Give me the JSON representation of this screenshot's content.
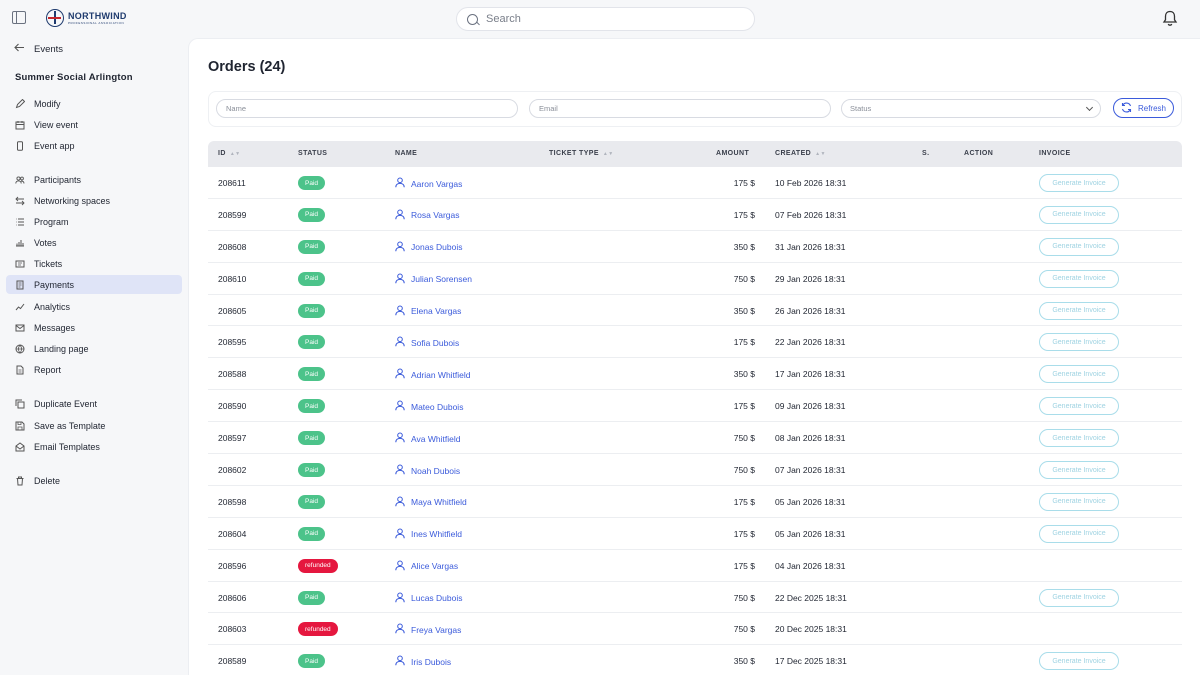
{
  "header": {
    "logo_name": "NORTHWIND",
    "logo_sub": "PROFESSIONAL ASSOCIATION",
    "search_placeholder": "Search"
  },
  "sidebar": {
    "back_label": "Events",
    "event_title": "Summer Social Arlington",
    "items": [
      {
        "label": "Modify",
        "icon": "pencil-icon"
      },
      {
        "label": "View event",
        "icon": "calendar-icon"
      },
      {
        "label": "Event app",
        "icon": "phone-icon"
      },
      {
        "label": "Participants",
        "icon": "people-icon"
      },
      {
        "label": "Networking spaces",
        "icon": "network-icon"
      },
      {
        "label": "Program",
        "icon": "list-icon"
      },
      {
        "label": "Votes",
        "icon": "vote-icon"
      },
      {
        "label": "Tickets",
        "icon": "ticket-icon"
      },
      {
        "label": "Payments",
        "icon": "receipt-icon",
        "active": true
      },
      {
        "label": "Analytics",
        "icon": "chart-icon"
      },
      {
        "label": "Messages",
        "icon": "mail-icon"
      },
      {
        "label": "Landing page",
        "icon": "globe-icon"
      },
      {
        "label": "Report",
        "icon": "document-icon"
      },
      {
        "label": "Duplicate Event",
        "icon": "copy-icon"
      },
      {
        "label": "Save as Template",
        "icon": "save-icon"
      },
      {
        "label": "Email Templates",
        "icon": "envelope-open-icon"
      },
      {
        "label": "Delete",
        "icon": "trash-icon"
      }
    ]
  },
  "main": {
    "title": "Orders (24)",
    "filters": {
      "name_placeholder": "Name",
      "email_placeholder": "Email",
      "status_placeholder": "Status",
      "refresh_label": "Refresh"
    },
    "columns": [
      "ID",
      "STATUS",
      "NAME",
      "TICKET TYPE",
      "AMOUNT",
      "CREATED",
      "S.",
      "ACTION",
      "INVOICE"
    ],
    "invoice_label": "Generate Invoice",
    "rows": [
      {
        "id": "208611",
        "status": "Paid",
        "name": "Aaron Vargas",
        "amount": "175 $",
        "created": "10 Feb 2026 18:31",
        "invoice": true
      },
      {
        "id": "208599",
        "status": "Paid",
        "name": "Rosa Vargas",
        "amount": "175 $",
        "created": "07 Feb 2026 18:31",
        "invoice": true
      },
      {
        "id": "208608",
        "status": "Paid",
        "name": "Jonas Dubois",
        "amount": "350 $",
        "created": "31 Jan 2026 18:31",
        "invoice": true
      },
      {
        "id": "208610",
        "status": "Paid",
        "name": "Julian Sorensen",
        "amount": "750 $",
        "created": "29 Jan 2026 18:31",
        "invoice": true
      },
      {
        "id": "208605",
        "status": "Paid",
        "name": "Elena Vargas",
        "amount": "350 $",
        "created": "26 Jan 2026 18:31",
        "invoice": true
      },
      {
        "id": "208595",
        "status": "Paid",
        "name": "Sofia Dubois",
        "amount": "175 $",
        "created": "22 Jan 2026 18:31",
        "invoice": true
      },
      {
        "id": "208588",
        "status": "Paid",
        "name": "Adrian Whitfield",
        "amount": "350 $",
        "created": "17 Jan 2026 18:31",
        "invoice": true
      },
      {
        "id": "208590",
        "status": "Paid",
        "name": "Mateo Dubois",
        "amount": "175 $",
        "created": "09 Jan 2026 18:31",
        "invoice": true
      },
      {
        "id": "208597",
        "status": "Paid",
        "name": "Ava Whitfield",
        "amount": "750 $",
        "created": "08 Jan 2026 18:31",
        "invoice": true
      },
      {
        "id": "208602",
        "status": "Paid",
        "name": "Noah Dubois",
        "amount": "750 $",
        "created": "07 Jan 2026 18:31",
        "invoice": true
      },
      {
        "id": "208598",
        "status": "Paid",
        "name": "Maya Whitfield",
        "amount": "175 $",
        "created": "05 Jan 2026 18:31",
        "invoice": true
      },
      {
        "id": "208604",
        "status": "Paid",
        "name": "Ines Whitfield",
        "amount": "175 $",
        "created": "05 Jan 2026 18:31",
        "invoice": true
      },
      {
        "id": "208596",
        "status": "refunded",
        "name": "Alice Vargas",
        "amount": "175 $",
        "created": "04 Jan 2026 18:31",
        "invoice": false
      },
      {
        "id": "208606",
        "status": "Paid",
        "name": "Lucas Dubois",
        "amount": "750 $",
        "created": "22 Dec 2025 18:31",
        "invoice": true
      },
      {
        "id": "208603",
        "status": "refunded",
        "name": "Freya Vargas",
        "amount": "750 $",
        "created": "20 Dec 2025 18:31",
        "invoice": false
      },
      {
        "id": "208589",
        "status": "Paid",
        "name": "Iris Dubois",
        "amount": "350 $",
        "created": "17 Dec 2025 18:31",
        "invoice": true
      }
    ]
  },
  "colors": {
    "accent": "#3b5bdb",
    "paid": "#4cc38a",
    "refunded": "#e5173f",
    "active_nav": "#dfe4f7"
  }
}
